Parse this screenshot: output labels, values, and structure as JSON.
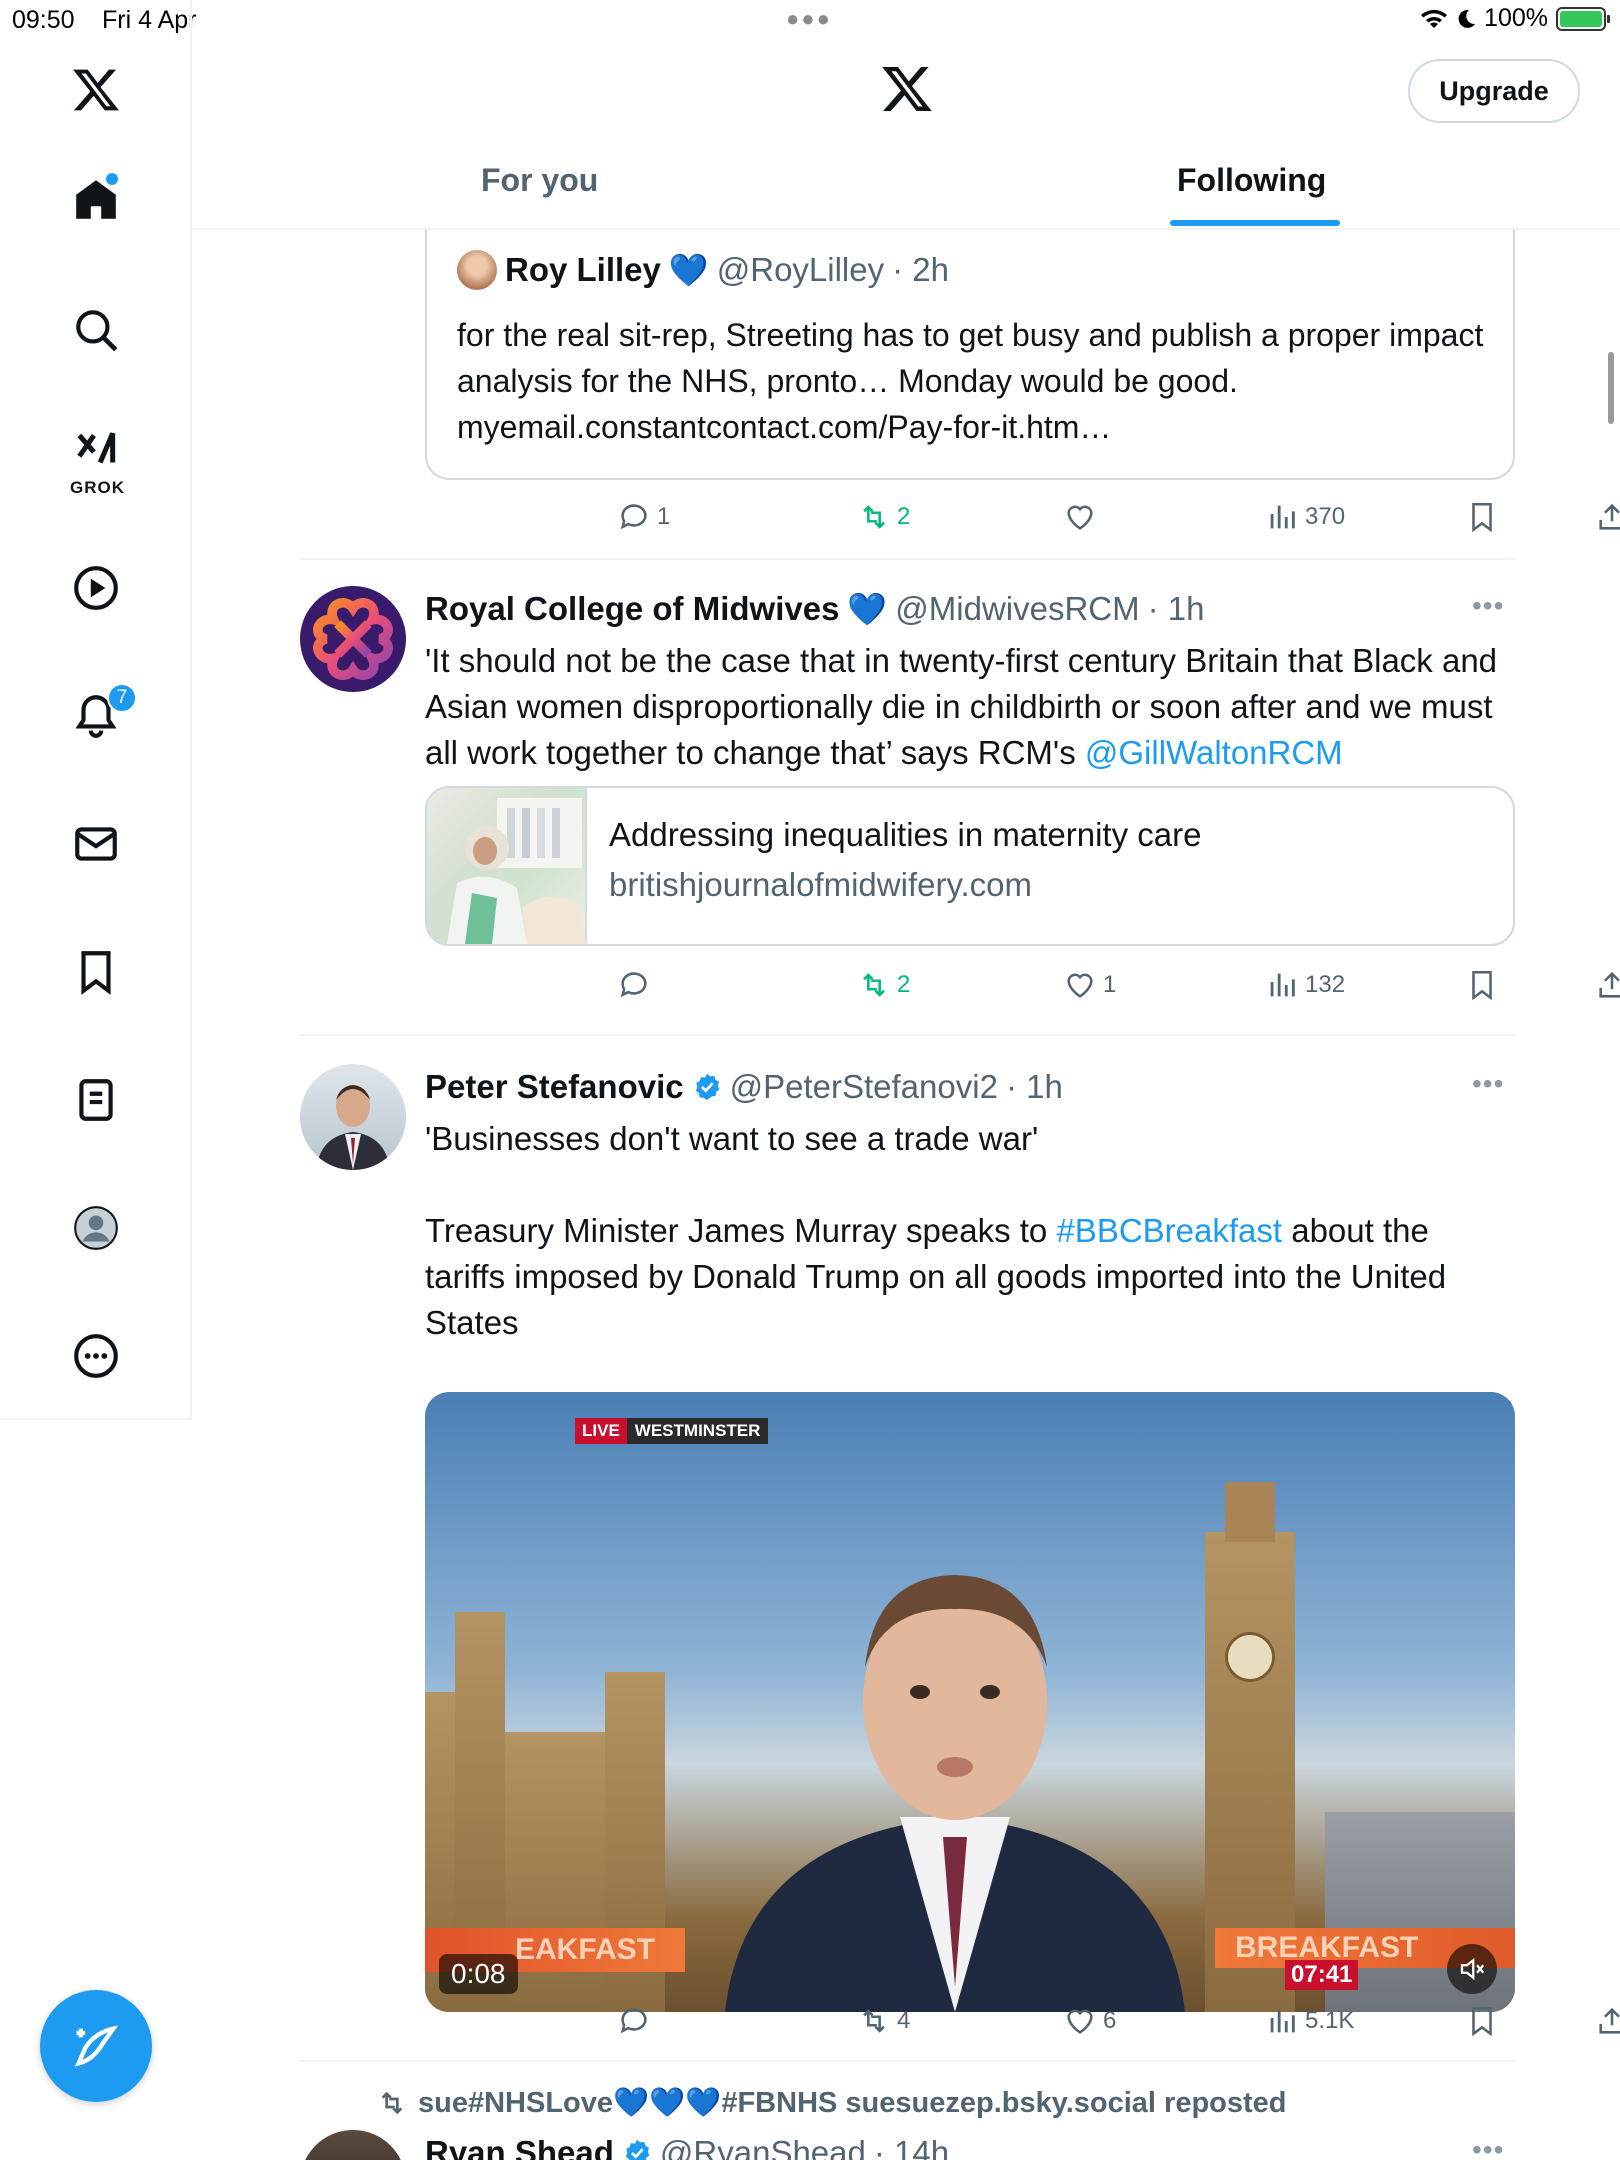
{
  "status_bar": {
    "time": "09:50",
    "date": "Fri 4 Apr",
    "battery": "100%"
  },
  "sidebar": {
    "grok_label": "GROK",
    "notifications_count": "7"
  },
  "header": {
    "upgrade_label": "Upgrade",
    "tabs": [
      {
        "label": "For you"
      },
      {
        "label": "Following"
      }
    ]
  },
  "quoted_tweet": {
    "name": "Roy Lilley",
    "handle": "@RoyLilley",
    "time": "· 2h",
    "text": "for the real sit-rep, Streeting has to get busy and publish a proper impact analysis for the NHS, pronto… Monday would be good.",
    "link": " myemail.constantcontact.com/Pay-for-it.htm…"
  },
  "tweets": [
    {
      "actions": {
        "replies": "1",
        "reposts": "2",
        "likes": "",
        "views": "370"
      }
    },
    {
      "name": "Royal College of Midwives",
      "handle": "@MidwivesRCM",
      "time": "· 1h",
      "text": "'It should not be the case that in twenty-first century Britain that Black and Asian women disproportionally die in childbirth or soon after and we must all work together to change that’ says RCM's ",
      "mention": "@GillWaltonRCM",
      "card_title": "Addressing inequalities in maternity care",
      "card_domain": "britishjournalofmidwifery.com",
      "actions": {
        "replies": "",
        "reposts": "2",
        "likes": "1",
        "views": "132"
      }
    },
    {
      "name": "Peter Stefanovic",
      "handle": "@PeterStefanovi2",
      "time": "· 1h",
      "text_line1": "'Businesses don't want to see a trade war'",
      "text_pre": "Treasury Minister James Murray speaks to ",
      "hashtag": "#BBCBreakfast",
      "text_post": " about the tariffs imposed by Donald Trump on all goods imported into the United States",
      "video": {
        "live_label": "LIVE",
        "location_label": "WESTMINSTER",
        "ticker_left": "EAKFAST",
        "ticker_right": "BREAKFAST",
        "clock": "07:41",
        "duration": "0:08"
      },
      "actions": {
        "replies": "",
        "reposts": "4",
        "likes": "6",
        "views": "5.1K"
      }
    },
    {
      "repost_by": "sue#NHSLove💙💙💙#FBNHS suesuezep.bsky.social reposted",
      "name": "Ryan Shead",
      "handle": "@RyanShead",
      "time": "· 14h"
    }
  ],
  "colors": {
    "accent": "#1d9bf0",
    "repost_green": "#00ba7c",
    "text": "#0f1419",
    "muted": "#536471"
  }
}
